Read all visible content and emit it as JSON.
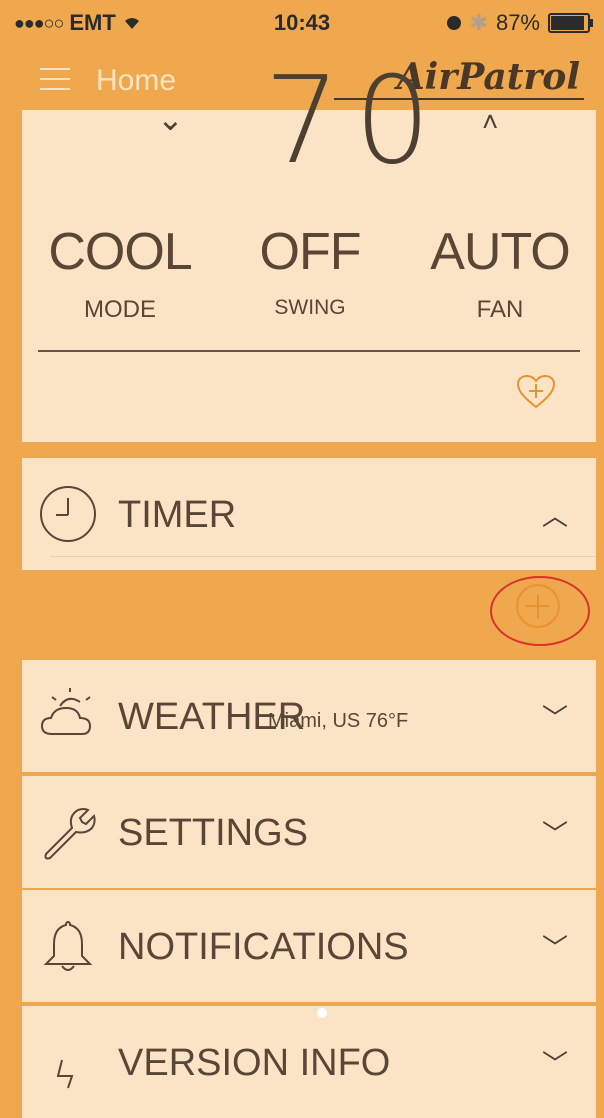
{
  "status_bar": {
    "signal_dots": "●●●○○",
    "carrier": "EMT",
    "wifi_icon": "wifi-icon",
    "time": "10:43",
    "battery_percent": "87%",
    "battery_level": 0.87
  },
  "nav": {
    "title": "Home",
    "brand": "AirPatrol"
  },
  "climate": {
    "temperature": "70",
    "mode": {
      "value": "COOL",
      "label": "MODE"
    },
    "swing": {
      "value": "OFF",
      "label": "SWING"
    },
    "fan": {
      "value": "AUTO",
      "label": "FAN"
    }
  },
  "sections": {
    "timer": {
      "title": "TIMER"
    },
    "weather": {
      "title": "WEATHER",
      "subtitle": "Miami, US 76°F"
    },
    "settings": {
      "title": "SETTINGS"
    },
    "notifications": {
      "title": "NOTIFICATIONS"
    },
    "version": {
      "title": "VERSION INFO"
    }
  },
  "colors": {
    "background": "#efa84e",
    "card": "#fbe4c6",
    "text": "#5a4636",
    "accent": "#e9932f",
    "highlight": "#d9332b"
  }
}
